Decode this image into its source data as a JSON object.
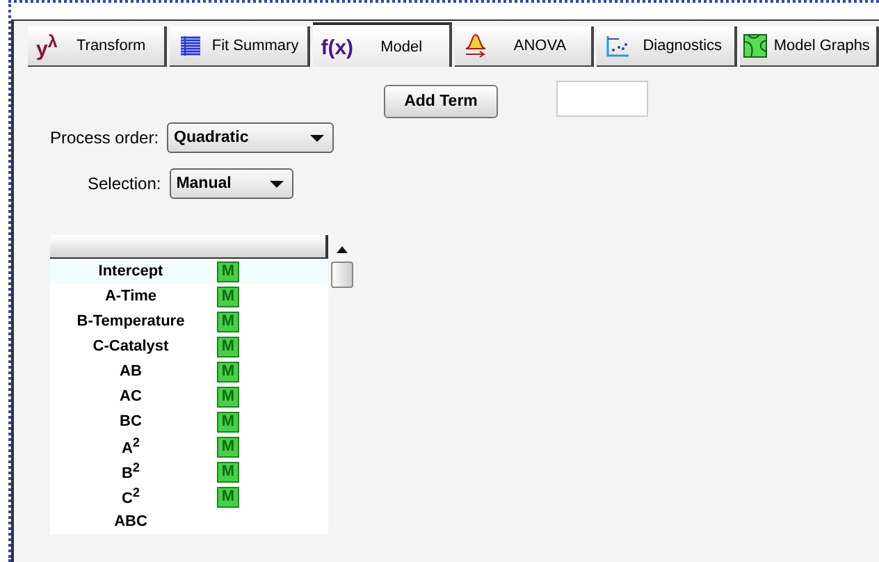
{
  "tabs": [
    {
      "label": "Transform",
      "kind": "glyph",
      "glyph": "y$^{λ}$",
      "selected": false
    },
    {
      "label": "Fit Summary",
      "kind": "table",
      "selected": false
    },
    {
      "label": "Model",
      "kind": "glyph",
      "glyph": "f(x)",
      "selected": true
    },
    {
      "label": "ANOVA",
      "kind": "curve",
      "selected": false
    },
    {
      "label": "Diagnostics",
      "kind": "scatter",
      "selected": false
    },
    {
      "label": "Model Graphs",
      "kind": "contour",
      "selected": false
    }
  ],
  "add_term_button": "Add Term",
  "process_order": {
    "label": "Process order:",
    "value": "Quadratic"
  },
  "selection": {
    "label": "Selection:",
    "value": "Manual"
  },
  "terms": [
    {
      "name": "Intercept",
      "mark": "M",
      "selected": true
    },
    {
      "name": "A-Time",
      "mark": "M",
      "selected": false
    },
    {
      "name": "B-Temperature",
      "mark": "M",
      "selected": false
    },
    {
      "name": "C-Catalyst",
      "mark": "M",
      "selected": false
    },
    {
      "name": "AB",
      "mark": "M",
      "selected": false
    },
    {
      "name": "AC",
      "mark": "M",
      "selected": false
    },
    {
      "name": "BC",
      "mark": "M",
      "selected": false
    },
    {
      "name": "A$^{2}$",
      "mark": "M",
      "selected": false
    },
    {
      "name": "B$^{2}$",
      "mark": "M",
      "selected": false
    },
    {
      "name": "C$^{2}$",
      "mark": "M",
      "selected": false
    },
    {
      "name": "ABC",
      "selected": false
    }
  ]
}
